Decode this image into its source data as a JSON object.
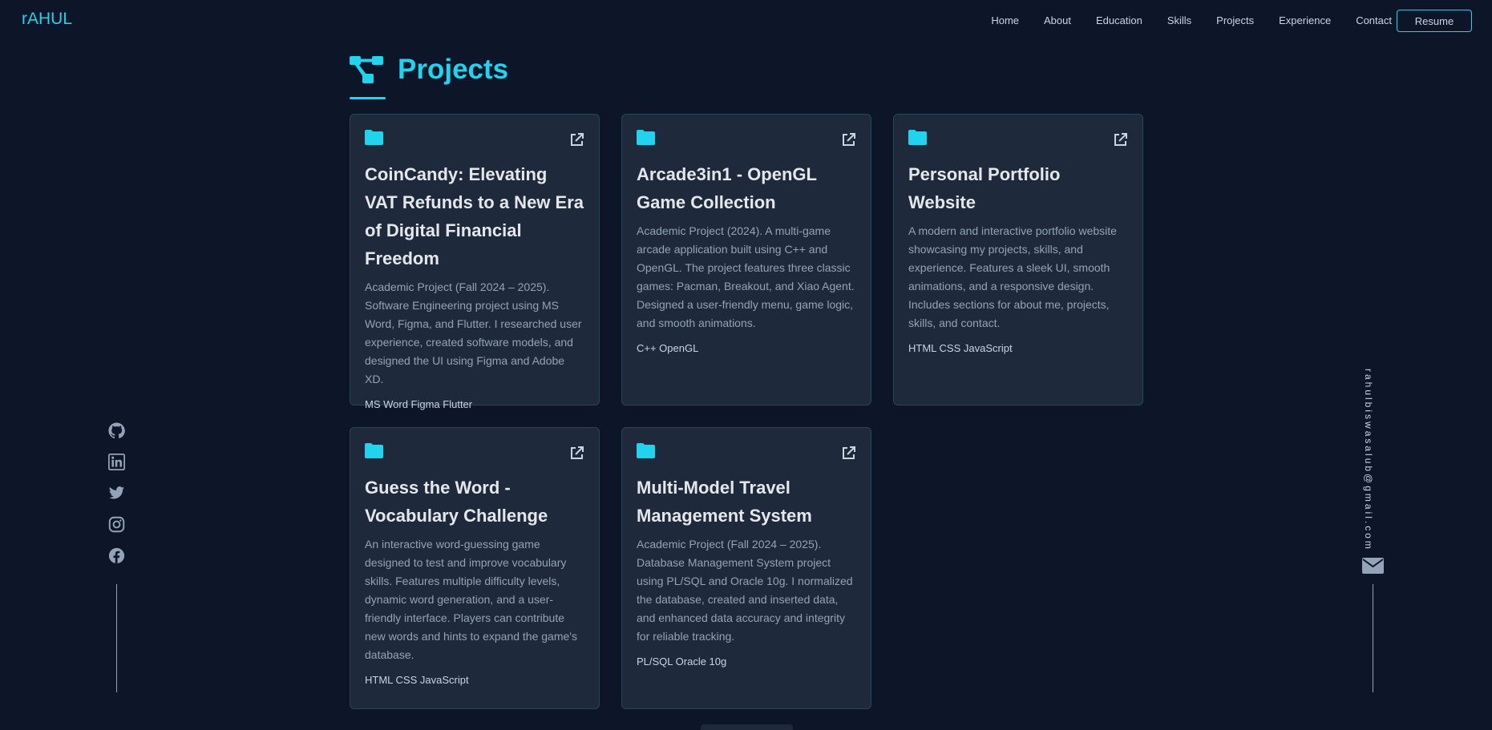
{
  "nav": {
    "logo": "rAHUL",
    "links": [
      "Home",
      "About",
      "Education",
      "Skills",
      "Projects",
      "Experience",
      "Contact"
    ],
    "resume_label": "Resume"
  },
  "section": {
    "title": "Projects"
  },
  "projects": [
    {
      "title": "CoinCandy: Elevating VAT Refunds to a New Era of Digital Financial Freedom",
      "description": "Academic Project (Fall 2024 – 2025). Software Engineering project using MS Word, Figma, and Flutter. I researched user experience, created software models, and designed the UI using Figma and Adobe XD.",
      "tech": "MS Word Figma Flutter"
    },
    {
      "title": "Arcade3in1 - OpenGL Game Collection",
      "description": "Academic Project (2024). A multi-game arcade application built using C++ and OpenGL. The project features three classic games: Pacman, Breakout, and Xiao Agent. Designed a user-friendly menu, game logic, and smooth animations.",
      "tech": "C++ OpenGL"
    },
    {
      "title": "Personal Portfolio Website",
      "description": "A modern and interactive portfolio website showcasing my projects, skills, and experience. Features a sleek UI, smooth animations, and a responsive design. Includes sections for about me, projects, skills, and contact.",
      "tech": "HTML CSS JavaScript"
    },
    {
      "title": "Guess the Word - Vocabulary Challenge",
      "description": "An interactive word-guessing game designed to test and improve vocabulary skills. Features multiple difficulty levels, dynamic word generation, and a user-friendly interface. Players can contribute new words and hints to expand the game's database.",
      "tech": "HTML CSS JavaScript"
    },
    {
      "title": "Multi-Model Travel Management System",
      "description": "Academic Project (Fall 2024 – 2025). Database Management System project using PL/SQL and Oracle 10g. I normalized the database, created and inserted data, and enhanced data accuracy and integrity for reliable tracking.",
      "tech": "PL/SQL Oracle 10g"
    }
  ],
  "social": [
    "github-icon",
    "linkedin-icon",
    "twitter-icon",
    "instagram-icon",
    "facebook-icon"
  ],
  "email": "rahulbiswasalub@gmail.com",
  "colors": {
    "accent": "#22d3ee",
    "background": "#0d1628",
    "card": "#1e293b"
  }
}
